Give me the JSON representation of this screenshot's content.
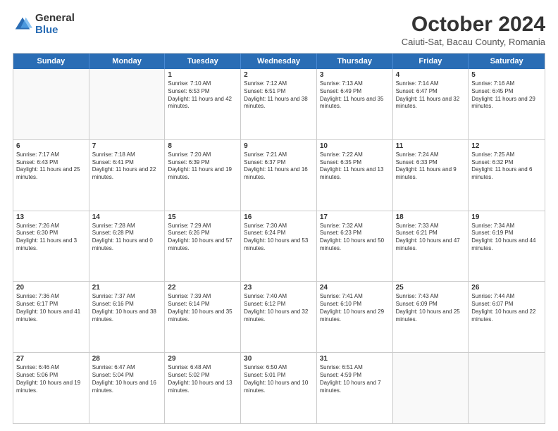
{
  "logo": {
    "general": "General",
    "blue": "Blue"
  },
  "title": "October 2024",
  "subtitle": "Caiuti-Sat, Bacau County, Romania",
  "header_days": [
    "Sunday",
    "Monday",
    "Tuesday",
    "Wednesday",
    "Thursday",
    "Friday",
    "Saturday"
  ],
  "weeks": [
    [
      {
        "day": "",
        "content": "",
        "empty": true
      },
      {
        "day": "",
        "content": "",
        "empty": true
      },
      {
        "day": "1",
        "content": "Sunrise: 7:10 AM\nSunset: 6:53 PM\nDaylight: 11 hours and 42 minutes."
      },
      {
        "day": "2",
        "content": "Sunrise: 7:12 AM\nSunset: 6:51 PM\nDaylight: 11 hours and 38 minutes."
      },
      {
        "day": "3",
        "content": "Sunrise: 7:13 AM\nSunset: 6:49 PM\nDaylight: 11 hours and 35 minutes."
      },
      {
        "day": "4",
        "content": "Sunrise: 7:14 AM\nSunset: 6:47 PM\nDaylight: 11 hours and 32 minutes."
      },
      {
        "day": "5",
        "content": "Sunrise: 7:16 AM\nSunset: 6:45 PM\nDaylight: 11 hours and 29 minutes."
      }
    ],
    [
      {
        "day": "6",
        "content": "Sunrise: 7:17 AM\nSunset: 6:43 PM\nDaylight: 11 hours and 25 minutes."
      },
      {
        "day": "7",
        "content": "Sunrise: 7:18 AM\nSunset: 6:41 PM\nDaylight: 11 hours and 22 minutes."
      },
      {
        "day": "8",
        "content": "Sunrise: 7:20 AM\nSunset: 6:39 PM\nDaylight: 11 hours and 19 minutes."
      },
      {
        "day": "9",
        "content": "Sunrise: 7:21 AM\nSunset: 6:37 PM\nDaylight: 11 hours and 16 minutes."
      },
      {
        "day": "10",
        "content": "Sunrise: 7:22 AM\nSunset: 6:35 PM\nDaylight: 11 hours and 13 minutes."
      },
      {
        "day": "11",
        "content": "Sunrise: 7:24 AM\nSunset: 6:33 PM\nDaylight: 11 hours and 9 minutes."
      },
      {
        "day": "12",
        "content": "Sunrise: 7:25 AM\nSunset: 6:32 PM\nDaylight: 11 hours and 6 minutes."
      }
    ],
    [
      {
        "day": "13",
        "content": "Sunrise: 7:26 AM\nSunset: 6:30 PM\nDaylight: 11 hours and 3 minutes."
      },
      {
        "day": "14",
        "content": "Sunrise: 7:28 AM\nSunset: 6:28 PM\nDaylight: 11 hours and 0 minutes."
      },
      {
        "day": "15",
        "content": "Sunrise: 7:29 AM\nSunset: 6:26 PM\nDaylight: 10 hours and 57 minutes."
      },
      {
        "day": "16",
        "content": "Sunrise: 7:30 AM\nSunset: 6:24 PM\nDaylight: 10 hours and 53 minutes."
      },
      {
        "day": "17",
        "content": "Sunrise: 7:32 AM\nSunset: 6:23 PM\nDaylight: 10 hours and 50 minutes."
      },
      {
        "day": "18",
        "content": "Sunrise: 7:33 AM\nSunset: 6:21 PM\nDaylight: 10 hours and 47 minutes."
      },
      {
        "day": "19",
        "content": "Sunrise: 7:34 AM\nSunset: 6:19 PM\nDaylight: 10 hours and 44 minutes."
      }
    ],
    [
      {
        "day": "20",
        "content": "Sunrise: 7:36 AM\nSunset: 6:17 PM\nDaylight: 10 hours and 41 minutes."
      },
      {
        "day": "21",
        "content": "Sunrise: 7:37 AM\nSunset: 6:16 PM\nDaylight: 10 hours and 38 minutes."
      },
      {
        "day": "22",
        "content": "Sunrise: 7:39 AM\nSunset: 6:14 PM\nDaylight: 10 hours and 35 minutes."
      },
      {
        "day": "23",
        "content": "Sunrise: 7:40 AM\nSunset: 6:12 PM\nDaylight: 10 hours and 32 minutes."
      },
      {
        "day": "24",
        "content": "Sunrise: 7:41 AM\nSunset: 6:10 PM\nDaylight: 10 hours and 29 minutes."
      },
      {
        "day": "25",
        "content": "Sunrise: 7:43 AM\nSunset: 6:09 PM\nDaylight: 10 hours and 25 minutes."
      },
      {
        "day": "26",
        "content": "Sunrise: 7:44 AM\nSunset: 6:07 PM\nDaylight: 10 hours and 22 minutes."
      }
    ],
    [
      {
        "day": "27",
        "content": "Sunrise: 6:46 AM\nSunset: 5:06 PM\nDaylight: 10 hours and 19 minutes."
      },
      {
        "day": "28",
        "content": "Sunrise: 6:47 AM\nSunset: 5:04 PM\nDaylight: 10 hours and 16 minutes."
      },
      {
        "day": "29",
        "content": "Sunrise: 6:48 AM\nSunset: 5:02 PM\nDaylight: 10 hours and 13 minutes."
      },
      {
        "day": "30",
        "content": "Sunrise: 6:50 AM\nSunset: 5:01 PM\nDaylight: 10 hours and 10 minutes."
      },
      {
        "day": "31",
        "content": "Sunrise: 6:51 AM\nSunset: 4:59 PM\nDaylight: 10 hours and 7 minutes."
      },
      {
        "day": "",
        "content": "",
        "empty": true
      },
      {
        "day": "",
        "content": "",
        "empty": true
      }
    ]
  ]
}
